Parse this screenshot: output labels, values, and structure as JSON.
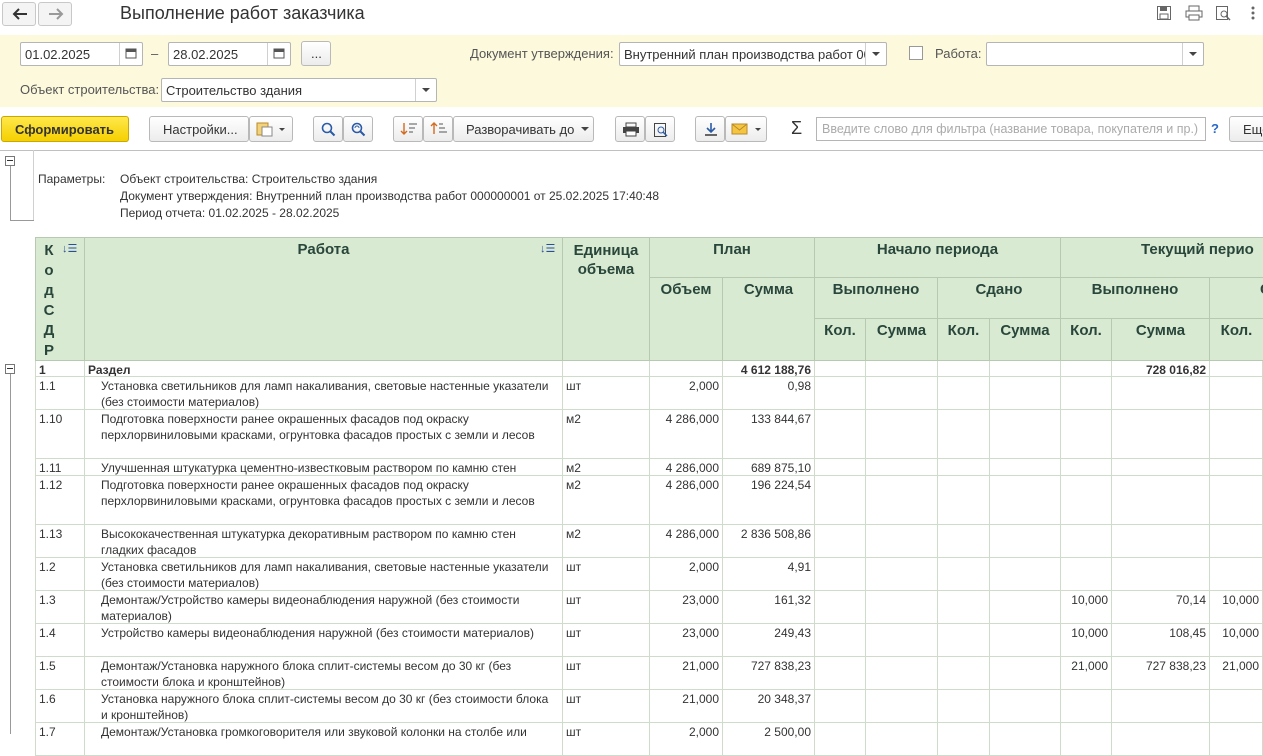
{
  "window": {
    "title": "Выполнение работ заказчика"
  },
  "params": {
    "date_from": "01.02.2025",
    "date_sep": "–",
    "date_to": "28.02.2025",
    "more_button": "...",
    "approval_doc_label": "Документ утверждения:",
    "approval_doc_value": "Внутренний план производства работ 00",
    "work_label": "Работа:",
    "work_value": "",
    "object_label": "Объект строительства:",
    "object_value": "Строительство здания"
  },
  "toolbar": {
    "generate": "Сформировать",
    "settings": "Настройки...",
    "expand_to": "Разворачивать до",
    "sigma": "Σ",
    "filter_placeholder": "Введите слово для фильтра (название товара, покупателя и пр.)",
    "help": "?",
    "more": "Еще"
  },
  "report": {
    "params_label": "Параметры:",
    "param_lines": [
      "Объект строительства: Строительство здания",
      "Документ утверждения: Внутренний план производства работ 000000001 от 25.02.2025 17:40:48",
      "Период отчета: 01.02.2025 - 28.02.2025"
    ],
    "headers": {
      "code": "К о д С Д Р",
      "work": "Работа",
      "unit": "Единица объема",
      "plan": "План",
      "plan_volume": "Объем",
      "plan_sum": "Сумма",
      "start": "Начало периода",
      "start_done": "Выполнено",
      "start_delivered": "Сдано",
      "current": "Текущий перио",
      "current_done": "Выполнено",
      "current_delivered": "С",
      "qty": "Кол.",
      "sum": "Сумма"
    },
    "rows": [
      {
        "code": "1",
        "work": "Раздел",
        "unit": "",
        "vol": "",
        "sum": "4 612 188,76",
        "cq": "",
        "cs": "728 016,82",
        "dq": "",
        "bold": true
      },
      {
        "code": "1.1",
        "work": "Установка светильников для ламп накаливания, световые настенные указатели (без стоимости материалов)",
        "unit": "шт",
        "vol": "2,000",
        "sum": "0,98",
        "cq": "",
        "cs": "",
        "dq": ""
      },
      {
        "code": "1.10",
        "work": "Подготовка поверхности ранее окрашенных фасадов под окраску перхлорвиниловыми красками, огрунтовка фасадов простых с земли и лесов",
        "unit": "м2",
        "vol": "4 286,000",
        "sum": "133 844,67",
        "cq": "",
        "cs": "",
        "dq": ""
      },
      {
        "code": "1.11",
        "work": "Улучшенная штукатурка цементно-известковым раствором по камню стен",
        "unit": "м2",
        "vol": "4 286,000",
        "sum": "689 875,10",
        "cq": "",
        "cs": "",
        "dq": ""
      },
      {
        "code": "1.12",
        "work": "Подготовка поверхности ранее окрашенных фасадов под окраску перхлорвиниловыми красками, огрунтовка фасадов простых с земли и лесов",
        "unit": "м2",
        "vol": "4 286,000",
        "sum": "196 224,54",
        "cq": "",
        "cs": "",
        "dq": ""
      },
      {
        "code": "1.13",
        "work": "Высококачественная штукатурка декоративным раствором по камню стен гладких фасадов",
        "unit": "м2",
        "vol": "4 286,000",
        "sum": "2 836 508,86",
        "cq": "",
        "cs": "",
        "dq": ""
      },
      {
        "code": "1.2",
        "work": "Установка светильников для ламп накаливания, световые настенные указатели (без стоимости материалов)",
        "unit": "шт",
        "vol": "2,000",
        "sum": "4,91",
        "cq": "",
        "cs": "",
        "dq": ""
      },
      {
        "code": "1.3",
        "work": "Демонтаж/Устройство камеры видеонаблюдения наружной (без стоимости материалов)",
        "unit": "шт",
        "vol": "23,000",
        "sum": "161,32",
        "cq": "10,000",
        "cs": "70,14",
        "dq": "10,000"
      },
      {
        "code": "1.4",
        "work": "Устройство камеры видеонаблюдения наружной (без стоимости материалов)",
        "unit": "шт",
        "vol": "23,000",
        "sum": "249,43",
        "cq": "10,000",
        "cs": "108,45",
        "dq": "10,000"
      },
      {
        "code": "1.5",
        "work": "Демонтаж/Установка наружного блока сплит-системы весом до 30 кг (без стоимости блока и кронштейнов)",
        "unit": "шт",
        "vol": "21,000",
        "sum": "727 838,23",
        "cq": "21,000",
        "cs": "727 838,23",
        "dq": "21,000"
      },
      {
        "code": "1.6",
        "work": "Установка наружного блока сплит-системы весом до 30 кг (без стоимости блока и кронштейнов)",
        "unit": "шт",
        "vol": "21,000",
        "sum": "20 348,37",
        "cq": "",
        "cs": "",
        "dq": ""
      },
      {
        "code": "1.7",
        "work": "Демонтаж/Установка громкоговорителя или звуковой колонки на столбе или",
        "unit": "шт",
        "vol": "2,000",
        "sum": "2 500,00",
        "cq": "",
        "cs": "",
        "dq": ""
      }
    ]
  }
}
